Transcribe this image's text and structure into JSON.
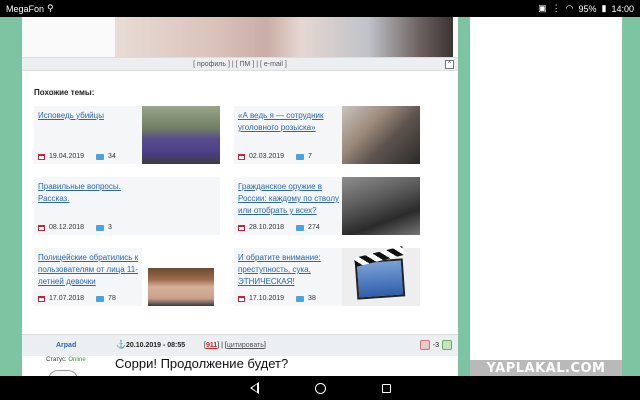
{
  "statusbar": {
    "carrier": "MegaFon",
    "battery": "95%",
    "time": "14:00"
  },
  "post_footer": {
    "profile": "профиль",
    "pm": "ПМ",
    "email": "e-mail",
    "up": "^"
  },
  "similar": {
    "title": "Похожие темы:",
    "cards": [
      {
        "title": "Исповедь убийцы",
        "date": "19.04.2019",
        "comments": "34"
      },
      {
        "title": "«А ведь я — сотрудник уголовного розыска»",
        "date": "02.03.2019",
        "comments": "7"
      },
      {
        "title": "Правильные вопросы. Рассказ.",
        "date": "08.12.2018",
        "comments": "3"
      },
      {
        "title": "Гражданское оружие в России: каждому по стволу или отобрать у всех?",
        "date": "28.10.2018",
        "comments": "274"
      },
      {
        "title": "Полицейские обратились к пользователям от лица 11-летней девочки",
        "date": "17.07.2018",
        "comments": "78"
      },
      {
        "title": "И обратите внимание: преступность, сука, ЭТНИЧЕСКАЯ!",
        "date": "17.10.2019",
        "comments": "38"
      }
    ]
  },
  "comment": {
    "author": "Arpad",
    "datetime": "20.10.2019 - 08:55",
    "number": "911",
    "quote_label": "цитировать",
    "rating": "-3",
    "status_label": "Статус:",
    "status_value": "Online",
    "text": "Сорри! Продолжение будет?"
  },
  "watermark": "YAPLAKAL.COM"
}
